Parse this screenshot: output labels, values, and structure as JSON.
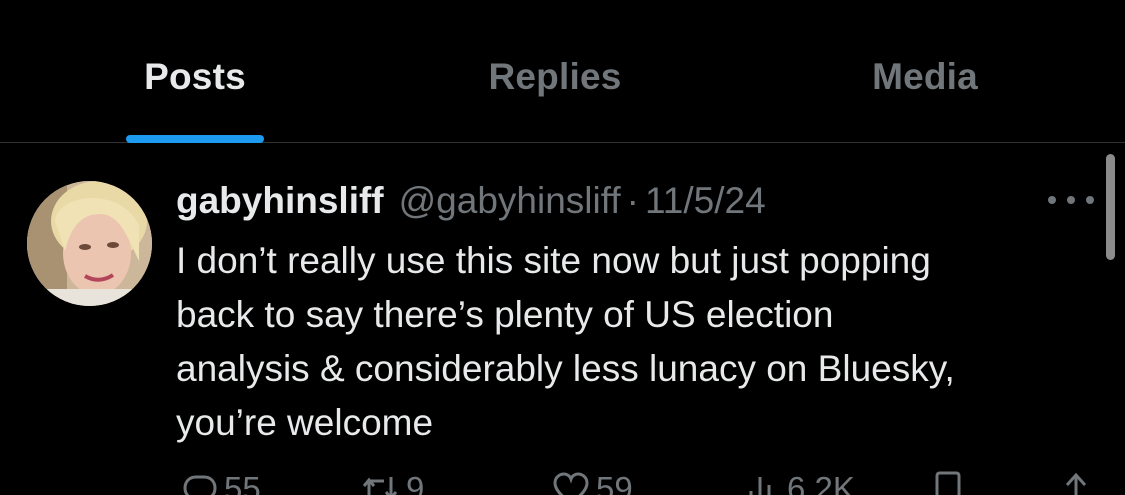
{
  "tabs": [
    {
      "label": "Posts",
      "active": true
    },
    {
      "label": "Replies",
      "active": false
    },
    {
      "label": "Media",
      "active": false
    }
  ],
  "post": {
    "display_name": "gabyhinsliff",
    "handle": "@gabyhinsliff",
    "separator": "·",
    "timestamp": "11/5/24",
    "text": "I don’t really use this site now but just popping\nback to say there’s plenty of US election\nanalysis & considerably less lunacy on Bluesky,\nyou’re welcome",
    "actions": {
      "replies": "55",
      "reposts": "9",
      "likes": "59",
      "views": "6.2K"
    }
  },
  "colors": {
    "background": "#000000",
    "primary_text": "#e7e9ea",
    "secondary_text": "#71767b",
    "accent": "#1d9bf0",
    "divider": "#2f3336"
  },
  "icons": {
    "reply": "speech-bubble-icon",
    "repost": "repost-arrows-icon",
    "like": "heart-icon",
    "views": "bar-chart-icon",
    "bookmark": "bookmark-icon",
    "share": "share-arrow-icon",
    "more": "more-dots-icon"
  }
}
